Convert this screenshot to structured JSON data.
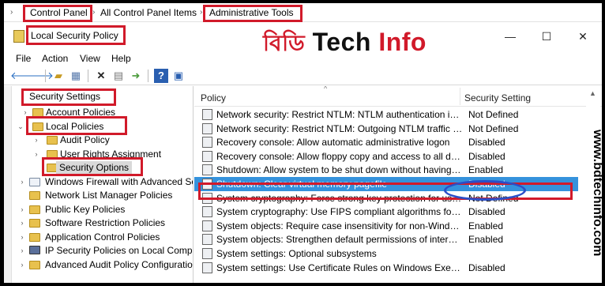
{
  "breadcrumb": {
    "items": [
      "Control Panel",
      "All Control Panel Items",
      "Administrative Tools"
    ]
  },
  "window": {
    "title": "Local Security Policy",
    "brand_bengali": "বিডি",
    "brand_tech": "Tech",
    "brand_info": "Info",
    "minimize": "—",
    "maximize": "☐",
    "close": "✕"
  },
  "menu": [
    "File",
    "Action",
    "View",
    "Help"
  ],
  "toolbar": {
    "icons": [
      "back-icon",
      "forward-icon",
      "up-folder-icon",
      "show-hide-tree-icon",
      "delete-icon",
      "properties-icon",
      "export-icon",
      "help-icon",
      "console-icon"
    ]
  },
  "tree": {
    "root": "Security Settings",
    "items": [
      {
        "label": "Account Policies"
      },
      {
        "label": "Local Policies"
      },
      {
        "label": "Audit Policy"
      },
      {
        "label": "User Rights Assignment"
      },
      {
        "label": "Security Options"
      },
      {
        "label": "Windows Firewall with Advanced Security"
      },
      {
        "label": "Network List Manager Policies"
      },
      {
        "label": "Public Key Policies"
      },
      {
        "label": "Software Restriction Policies"
      },
      {
        "label": "Application Control Policies"
      },
      {
        "label": "IP Security Policies on Local Computer"
      },
      {
        "label": "Advanced Audit Policy Configuration"
      }
    ]
  },
  "list": {
    "columns": [
      "Policy",
      "Security Setting"
    ],
    "rows": [
      {
        "policy": "Network security: Restrict NTLM: NTLM authentication in this domain",
        "setting": "Not Defined"
      },
      {
        "policy": "Network security: Restrict NTLM: Outgoing NTLM traffic to remote servers",
        "setting": "Not Defined"
      },
      {
        "policy": "Recovery console: Allow automatic administrative logon",
        "setting": "Disabled"
      },
      {
        "policy": "Recovery console: Allow floppy copy and access to all drives and all folders",
        "setting": "Disabled"
      },
      {
        "policy": "Shutdown: Allow system to be shut down without having to log on",
        "setting": "Enabled"
      },
      {
        "policy": "Shutdown: Clear virtual memory pagefile",
        "setting": "Disabled"
      },
      {
        "policy": "System cryptography: Force strong key protection for user keys stored on the computer",
        "setting": "Not Defined"
      },
      {
        "policy": "System cryptography: Use FIPS compliant algorithms for encryption, hashing, and signing",
        "setting": "Disabled"
      },
      {
        "policy": "System objects: Require case insensitivity for non-Windows subsystems",
        "setting": "Enabled"
      },
      {
        "policy": "System objects: Strengthen default permissions of internal system objects",
        "setting": "Enabled"
      },
      {
        "policy": "System settings: Optional subsystems",
        "setting": ""
      },
      {
        "policy": "System settings: Use Certificate Rules on Windows Executables for Software Restriction Policies",
        "setting": "Disabled"
      }
    ]
  },
  "watermark": "www.bdtechinfo.com",
  "colors": {
    "highlight": "#d11a2a",
    "selection": "#3592dc",
    "oval": "#2a4fc8"
  }
}
